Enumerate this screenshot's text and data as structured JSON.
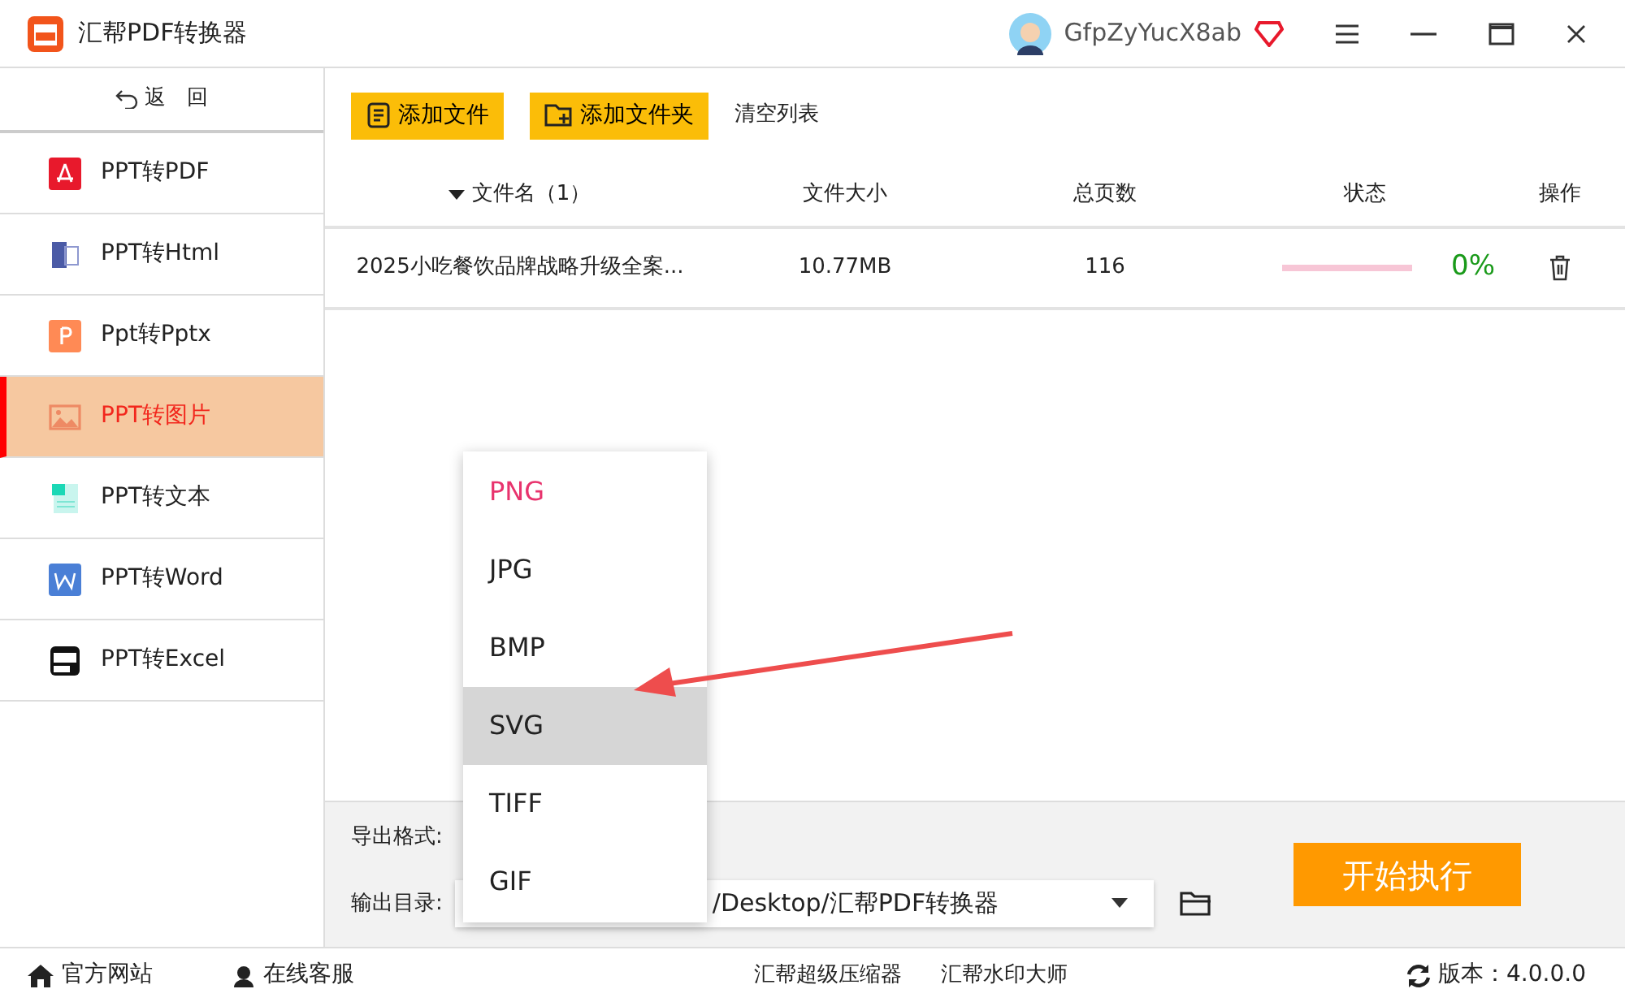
{
  "window": {
    "title": "汇帮PDF转换器",
    "user": "GfpZyYucX8ab"
  },
  "back": "返　回",
  "sidebar": {
    "items": [
      {
        "label": "PPT转PDF",
        "kind": "pdf",
        "selected": false
      },
      {
        "label": "PPT转Html",
        "kind": "html",
        "selected": false
      },
      {
        "label": "Ppt转Pptx",
        "kind": "pptx",
        "selected": false
      },
      {
        "label": "PPT转图片",
        "kind": "image",
        "selected": true
      },
      {
        "label": "PPT转文本",
        "kind": "text",
        "selected": false
      },
      {
        "label": "PPT转Word",
        "kind": "word",
        "selected": false
      },
      {
        "label": "PPT转Excel",
        "kind": "excel",
        "selected": false
      }
    ]
  },
  "toolbar": {
    "add_file": "添加文件",
    "add_folder": "添加文件夹",
    "clear": "清空列表"
  },
  "table": {
    "columns": [
      "文件名（1）",
      "文件大小",
      "总页数",
      "状态",
      "操作"
    ],
    "rows": [
      {
        "name": "2025小吃餐饮品牌战略升级全案...",
        "size": "10.77MB",
        "pages": "116",
        "level": 0,
        "progress": "0%"
      }
    ]
  },
  "format": {
    "label": "导出格式:",
    "options": [
      {
        "label": "PNG",
        "selected": true,
        "highlighted": false
      },
      {
        "label": "JPG",
        "selected": false,
        "highlighted": false
      },
      {
        "label": "BMP",
        "selected": false,
        "highlighted": false
      },
      {
        "label": "SVG",
        "selected": false,
        "highlighted": true
      },
      {
        "label": "TIFF",
        "selected": false,
        "highlighted": false
      },
      {
        "label": "GIF",
        "selected": false,
        "highlighted": false
      }
    ]
  },
  "output": {
    "label": "输出目录:",
    "path": "/Desktop/汇帮PDF转换器"
  },
  "start": "开始执行",
  "status_bar": {
    "website": "官方网站",
    "support": "在线客服",
    "links": [
      "汇帮超级压缩器",
      "汇帮水印大师"
    ],
    "version": "版本：4.0.0.0"
  }
}
